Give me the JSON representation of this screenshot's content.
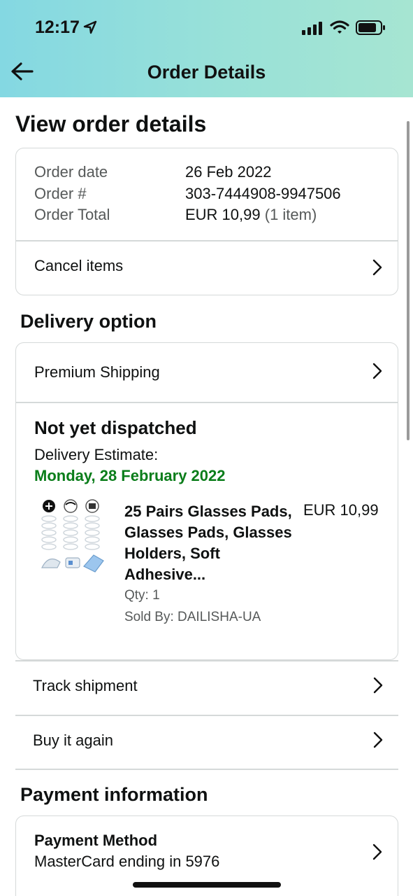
{
  "status_bar": {
    "time": "12:17"
  },
  "header": {
    "title": "Order Details"
  },
  "page_title": "View order details",
  "order_summary": {
    "rows": [
      {
        "label": "Order date",
        "value": "26 Feb 2022"
      },
      {
        "label": "Order #",
        "value": "303-7444908-9947506"
      },
      {
        "label": "Order Total",
        "value": "EUR 10,99",
        "extra": "(1 item)"
      }
    ],
    "cancel_label": "Cancel items"
  },
  "delivery": {
    "section_title": "Delivery option",
    "shipping_option": "Premium Shipping",
    "status": "Not yet dispatched",
    "estimate_label": "Delivery Estimate:",
    "estimate_date": "Monday, 28 February 2022",
    "estimate_color": "#0a7d1a",
    "item": {
      "title_lines": [
        "25 Pairs Glasses Pads,",
        "Glasses Pads, Glasses",
        "Holders, Soft",
        "Adhesive..."
      ],
      "price": "EUR 10,99",
      "qty": "Qty: 1",
      "seller": "Sold By: DAILISHA-UA"
    }
  },
  "actions": {
    "track": "Track shipment",
    "buy_again": "Buy it again"
  },
  "payment": {
    "section_title": "Payment information",
    "method_label": "Payment Method",
    "method_value": "MasterCard ending in 5976"
  },
  "colors": {
    "header_gradient_start": "#84d8e2",
    "header_gradient_end": "#a6e5d2",
    "border": "#d5d9d9"
  }
}
